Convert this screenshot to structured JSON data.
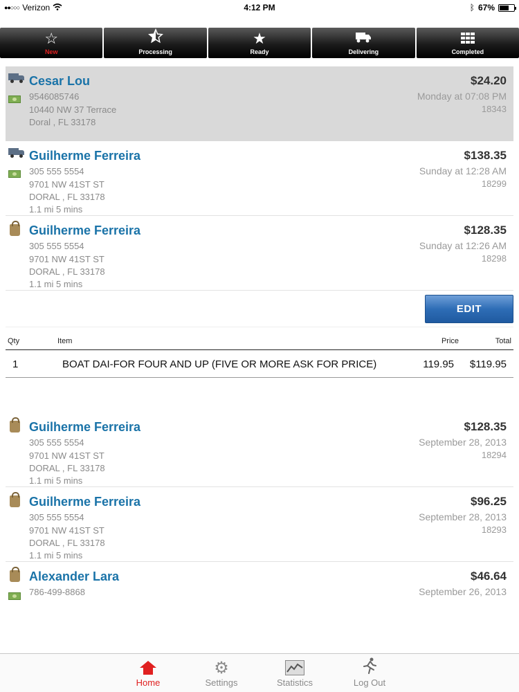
{
  "status_bar": {
    "carrier": "Verizon",
    "time": "4:12 PM",
    "battery": "67%",
    "battery_level": 0.67
  },
  "tabs": [
    {
      "label": "New",
      "icon": "star-outline-icon",
      "active": true
    },
    {
      "label": "Processing",
      "icon": "star-half-icon",
      "active": false
    },
    {
      "label": "Ready",
      "icon": "star-filled-icon",
      "active": false
    },
    {
      "label": "Delivering",
      "icon": "truck-icon",
      "active": false
    },
    {
      "label": "Completed",
      "icon": "grid-icon",
      "active": false
    }
  ],
  "orders": [
    {
      "name": "Cesar Lou",
      "phone": "9546085746",
      "address": "10440 NW 37 Terrace",
      "city": "Doral , FL 33178",
      "distance": "",
      "amount": "$24.20",
      "date": "Monday at 07:08 PM",
      "number": "18343",
      "type": "delivery",
      "payment": "cash",
      "selected": true
    },
    {
      "name": "Guilherme Ferreira",
      "phone": "305 555 5554",
      "address": "9701 NW 41ST ST",
      "city": "DORAL , FL 33178",
      "distance": "1.1 mi 5 mins",
      "amount": "$138.35",
      "date": "Sunday at 12:28 AM",
      "number": "18299",
      "type": "delivery",
      "payment": "cash"
    },
    {
      "name": "Guilherme Ferreira",
      "phone": "305 555 5554",
      "address": "9701 NW 41ST ST",
      "city": "DORAL , FL 33178",
      "distance": "1.1 mi 5 mins",
      "amount": "$128.35",
      "date": "Sunday at 12:26 AM",
      "number": "18298",
      "type": "pickup",
      "payment": ""
    }
  ],
  "detail": {
    "edit_label": "EDIT",
    "headers": {
      "qty": "Qty",
      "item": "Item",
      "price": "Price",
      "total": "Total"
    },
    "items": [
      {
        "qty": "1",
        "item": "BOAT DAI-FOR FOUR AND UP (FIVE OR MORE ASK FOR PRICE)",
        "price": "119.95",
        "total": "$119.95"
      }
    ]
  },
  "orders_after": [
    {
      "name": "Guilherme Ferreira",
      "phone": "305 555 5554",
      "address": "9701 NW 41ST ST",
      "city": "DORAL , FL 33178",
      "distance": "1.1 mi 5 mins",
      "amount": "$128.35",
      "date": "September 28, 2013",
      "number": "18294",
      "type": "pickup"
    },
    {
      "name": "Guilherme Ferreira",
      "phone": "305 555 5554",
      "address": "9701 NW 41ST ST",
      "city": "DORAL , FL 33178",
      "distance": "1.1 mi 5 mins",
      "amount": "$96.25",
      "date": "September 28, 2013",
      "number": "18293",
      "type": "pickup"
    },
    {
      "name": "Alexander Lara",
      "phone": "786-499-8868",
      "amount": "$46.64",
      "date": "September 26, 2013",
      "type": "pickup",
      "payment": "cash"
    }
  ],
  "toolbar": [
    {
      "label": "Home",
      "icon": "home-icon",
      "active": true
    },
    {
      "label": "Settings",
      "icon": "gear-icon",
      "active": false
    },
    {
      "label": "Statistics",
      "icon": "chart-icon",
      "active": false
    },
    {
      "label": "Log Out",
      "icon": "running-man-icon",
      "active": false
    }
  ],
  "colors": {
    "accent_red": "#e02020",
    "name_blue": "#1a73a8",
    "edit_blue": "#2e6db6",
    "selected_bg": "#d9d9d9"
  }
}
